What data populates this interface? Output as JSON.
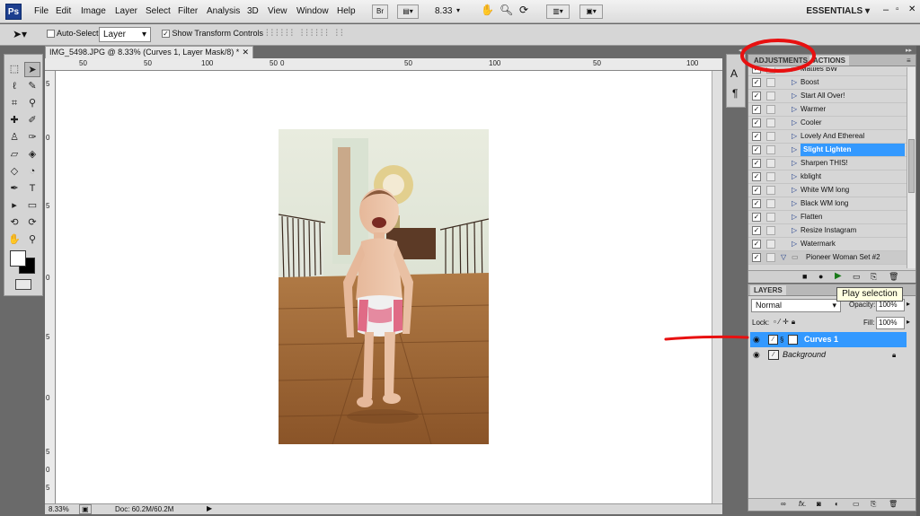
{
  "menubar": {
    "logo": "Ps",
    "items": [
      "File",
      "Edit",
      "Image",
      "Layer",
      "Select",
      "Filter",
      "Analysis",
      "3D",
      "View",
      "Window",
      "Help"
    ],
    "bridge_btn": "Br",
    "zoom": "8.33",
    "workspace": "ESSENTIALS"
  },
  "options": {
    "auto_select_label": "Auto-Select:",
    "auto_select_value": "Layer",
    "show_transform_label": "Show Transform Controls"
  },
  "document": {
    "tab_title": "IMG_5498.JPG @ 8.33% (Curves 1, Layer Mask/8) *",
    "ruler_h": [
      "50",
      "50",
      "100",
      "50",
      "0",
      "50",
      "100",
      "50",
      "100"
    ],
    "ruler_v": [
      "5",
      "0",
      "5",
      "0",
      "5",
      "0",
      "5",
      "0",
      "5"
    ],
    "zoom_status": "8.33%",
    "doc_status": "Doc: 60.2M/60.2M"
  },
  "adjustments_panel": {
    "tab_adjustments": "ADJUSTMENTS",
    "tab_actions": "ACTIONS",
    "actions": [
      {
        "label": "Matties BW",
        "checked": true
      },
      {
        "label": "Boost",
        "checked": true
      },
      {
        "label": "Start All Over!",
        "checked": true
      },
      {
        "label": "Warmer",
        "checked": true
      },
      {
        "label": "Cooler",
        "checked": true
      },
      {
        "label": "Lovely And Ethereal",
        "checked": true
      },
      {
        "label": "Slight Lighten",
        "checked": true,
        "selected": true
      },
      {
        "label": "Sharpen THIS!",
        "checked": true
      },
      {
        "label": "kblight",
        "checked": true
      },
      {
        "label": "White WM long",
        "checked": true
      },
      {
        "label": "Black WM long",
        "checked": true
      },
      {
        "label": "Flatten",
        "checked": true
      },
      {
        "label": "Resize Instagram",
        "checked": true
      },
      {
        "label": "Watermark",
        "checked": true
      },
      {
        "label": "Pioneer Woman Set #2",
        "checked": true,
        "folder": true
      }
    ]
  },
  "layers_panel": {
    "tab": "LAYERS",
    "blend_mode": "Normal",
    "opacity_label": "Opacity:",
    "opacity_value": "100%",
    "lock_label": "Lock:",
    "fill_label": "Fill:",
    "fill_value": "100%",
    "layers": [
      {
        "name": "Curves 1",
        "selected": true
      },
      {
        "name": "Background",
        "selected": false
      }
    ]
  },
  "tooltip": "Play selection",
  "colors": {
    "selection": "#3399ff",
    "annotation_red": "#e81010"
  }
}
